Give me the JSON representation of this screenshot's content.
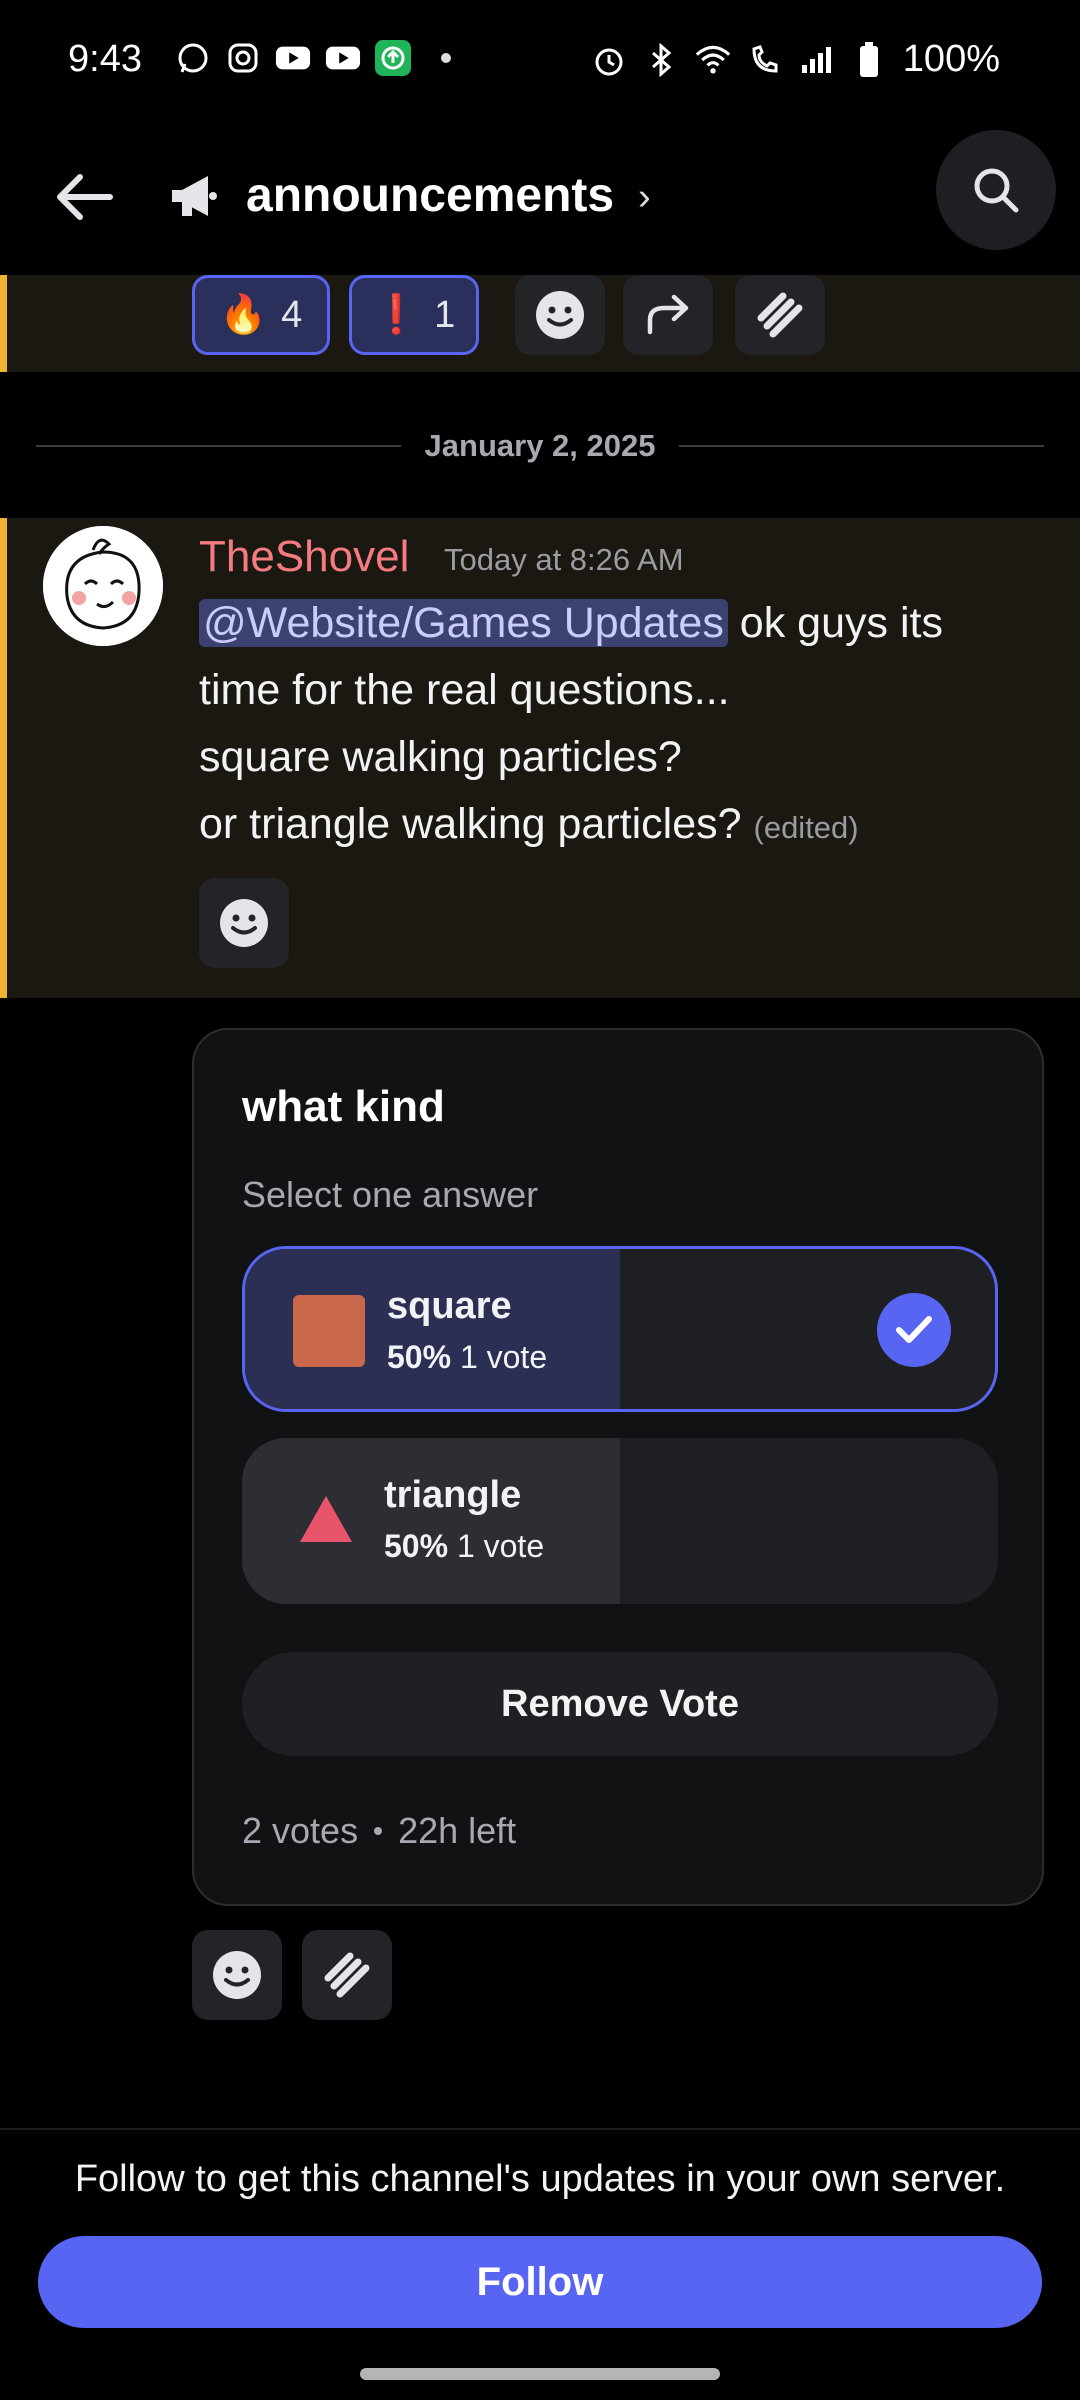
{
  "status_bar": {
    "time": "9:43",
    "battery": "100%",
    "left_icons": [
      "whatsapp-icon",
      "instagram-icon",
      "youtube-icon",
      "youtube-icon",
      "update-icon"
    ],
    "right_icons": [
      "alarm-icon",
      "bluetooth-icon",
      "wifi-icon",
      "wifi-calling-icon",
      "signal-icon",
      "battery-icon"
    ]
  },
  "header": {
    "channel_name": "announcements",
    "chevron": "›"
  },
  "top_reactions": [
    {
      "emoji": "🔥",
      "count": "4",
      "selected": true
    },
    {
      "emoji": "❗",
      "count": "1",
      "selected": true
    }
  ],
  "date_divider": "January 2, 2025",
  "message": {
    "author": "TheShovel",
    "timestamp": "Today at 8:26 AM",
    "mention": "@Website/Games Updates",
    "line1_rest": " ok guys its",
    "line2": "time for the real questions...",
    "line3": "square walking particles?",
    "line4": "or triangle walking particles?",
    "edited": "(edited)"
  },
  "poll": {
    "question": "what kind",
    "hint": "Select one answer",
    "options": [
      {
        "label": "square",
        "percent": "50%",
        "votes": "1 vote",
        "fraction": 0.5,
        "selected": true,
        "shape": "square",
        "color": "#c9684b"
      },
      {
        "label": "triangle",
        "percent": "50%",
        "votes": "1 vote",
        "fraction": 0.5,
        "selected": false,
        "shape": "triangle",
        "color": "#e8556a"
      }
    ],
    "remove_label": "Remove Vote",
    "total_votes": "2 votes",
    "time_left": "22h left"
  },
  "follow": {
    "text": "Follow to get this channel's updates in your own server.",
    "button": "Follow"
  },
  "colors": {
    "accent": "#5865f2",
    "highlight_bar": "#f0b232",
    "author": "#f47b80"
  }
}
